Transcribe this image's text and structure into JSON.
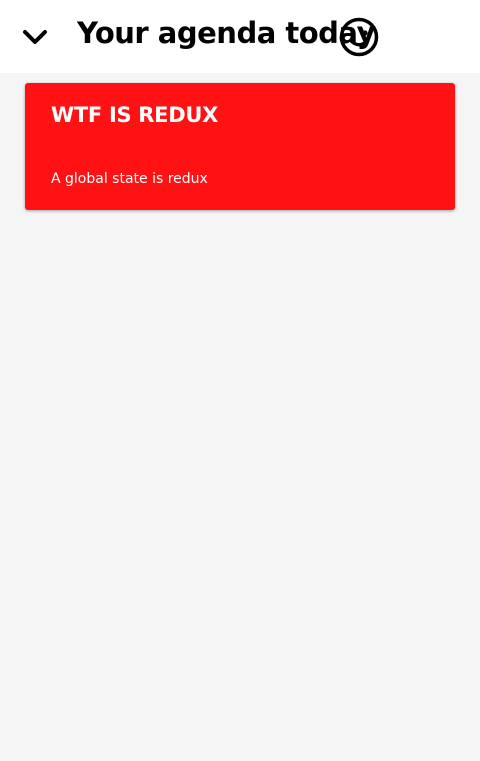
{
  "header": {
    "title": "Your agenda today",
    "collapse_icon": "chevron-down-icon",
    "mood_icon": "smiley-icon"
  },
  "agenda": {
    "items": [
      {
        "title": "WTF IS REDUX",
        "description": "A global state is redux",
        "color": "#ff1114"
      }
    ]
  },
  "colors": {
    "background": "#f5f5f5",
    "header_background": "#ffffff",
    "card_background": "#ff1114",
    "card_text": "#ffffff"
  }
}
